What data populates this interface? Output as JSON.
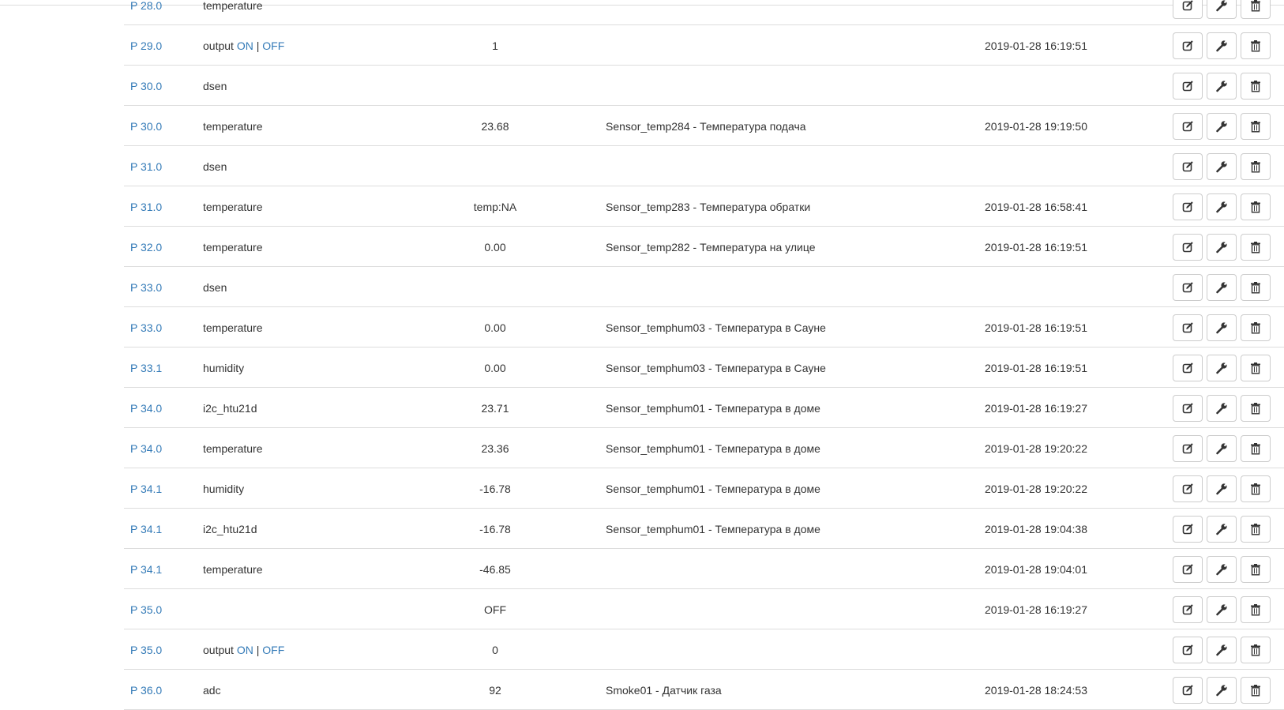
{
  "rows": [
    {
      "port": "P 28.0",
      "type_prefix": "temperature",
      "value": "",
      "description": "",
      "date": ""
    },
    {
      "port": "P 29.0",
      "type_prefix": "output",
      "on": "ON",
      "sep": "|",
      "off": "OFF",
      "value": "1",
      "description": "",
      "date": "2019-01-28 16:19:51"
    },
    {
      "port": "P 30.0",
      "type_prefix": "dsen",
      "value": "",
      "description": "",
      "date": ""
    },
    {
      "port": "P 30.0",
      "type_prefix": "temperature",
      "value": "23.68",
      "description": "Sensor_temp284 - Температура подача",
      "date": "2019-01-28 19:19:50"
    },
    {
      "port": "P 31.0",
      "type_prefix": "dsen",
      "value": "",
      "description": "",
      "date": ""
    },
    {
      "port": "P 31.0",
      "type_prefix": "temperature",
      "value": "temp:NA",
      "description": "Sensor_temp283 - Температура обратки",
      "date": "2019-01-28 16:58:41"
    },
    {
      "port": "P 32.0",
      "type_prefix": "temperature",
      "value": "0.00",
      "description": "Sensor_temp282 - Температура на улице",
      "date": "2019-01-28 16:19:51"
    },
    {
      "port": "P 33.0",
      "type_prefix": "dsen",
      "value": "",
      "description": "",
      "date": ""
    },
    {
      "port": "P 33.0",
      "type_prefix": "temperature",
      "value": "0.00",
      "description": "Sensor_temphum03 - Температура в Сауне",
      "date": "2019-01-28 16:19:51"
    },
    {
      "port": "P 33.1",
      "type_prefix": "humidity",
      "value": "0.00",
      "description": "Sensor_temphum03 - Температура в Сауне",
      "date": "2019-01-28 16:19:51"
    },
    {
      "port": "P 34.0",
      "type_prefix": "i2c_htu21d",
      "value": "23.71",
      "description": "Sensor_temphum01 - Температура в доме",
      "date": "2019-01-28 16:19:27"
    },
    {
      "port": "P 34.0",
      "type_prefix": "temperature",
      "value": "23.36",
      "description": "Sensor_temphum01 - Температура в доме",
      "date": "2019-01-28 19:20:22"
    },
    {
      "port": "P 34.1",
      "type_prefix": "humidity",
      "value": "-16.78",
      "description": "Sensor_temphum01 - Температура в доме",
      "date": "2019-01-28 19:20:22"
    },
    {
      "port": "P 34.1",
      "type_prefix": "i2c_htu21d",
      "value": "-16.78",
      "description": "Sensor_temphum01 - Температура в доме",
      "date": "2019-01-28 19:04:38"
    },
    {
      "port": "P 34.1",
      "type_prefix": "temperature",
      "value": "-46.85",
      "description": "",
      "date": "2019-01-28 19:04:01"
    },
    {
      "port": "P 35.0",
      "type_prefix": "",
      "value": "OFF",
      "description": "",
      "date": "2019-01-28 16:19:27"
    },
    {
      "port": "P 35.0",
      "type_prefix": "output",
      "on": "ON",
      "sep": "|",
      "off": "OFF",
      "value": "0",
      "description": "",
      "date": ""
    },
    {
      "port": "P 36.0",
      "type_prefix": "adc",
      "value": "92",
      "description": "Smoke01 - Датчик газа",
      "date": "2019-01-28 18:24:53"
    }
  ],
  "actions": {
    "edit_icon": "edit-icon",
    "settings_icon": "wrench-icon",
    "delete_icon": "trash-icon"
  },
  "colors": {
    "link": "#337ab7",
    "border": "#dddddd",
    "text": "#333333"
  }
}
